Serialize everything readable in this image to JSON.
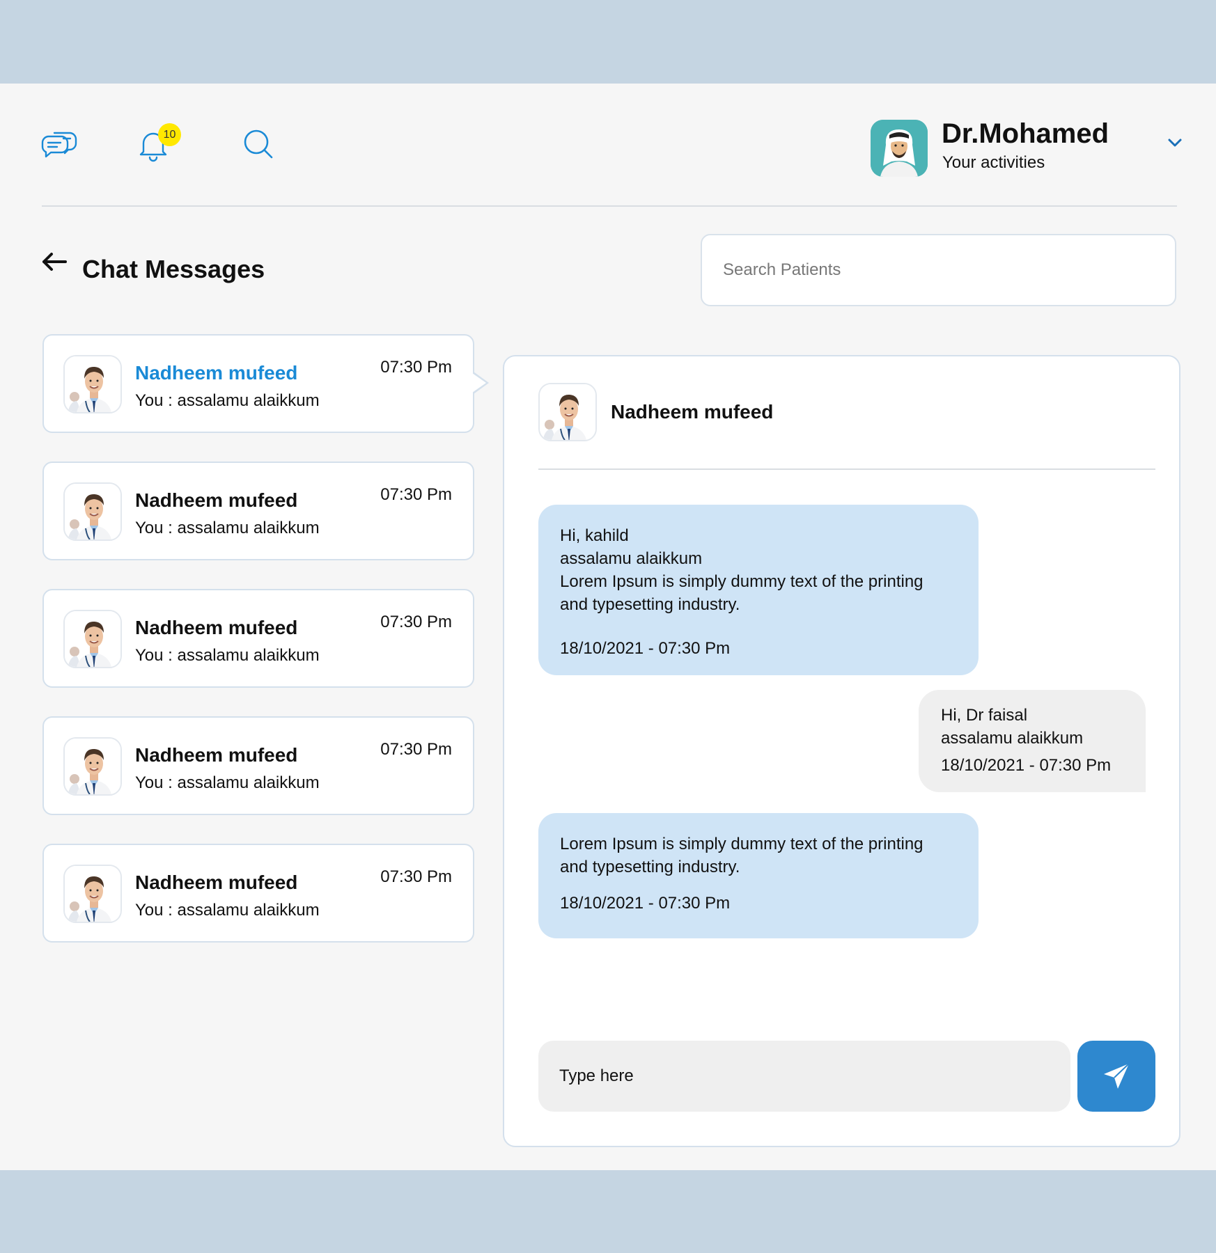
{
  "header": {
    "icons": [
      "chat-icon",
      "bell-icon",
      "search-icon"
    ],
    "notification_count": "10",
    "profile": {
      "name": "Dr.Mohamed",
      "subtitle": "Your activities"
    }
  },
  "page": {
    "title": "Chat Messages",
    "search_placeholder": "Search Patients"
  },
  "conversations": [
    {
      "name": "Nadheem mufeed",
      "preview": "You : assalamu alaikkum",
      "time": "07:30 Pm",
      "active": true
    },
    {
      "name": "Nadheem mufeed",
      "preview": "You : assalamu alaikkum",
      "time": "07:30 Pm",
      "active": false
    },
    {
      "name": "Nadheem mufeed",
      "preview": "You : assalamu alaikkum",
      "time": "07:30 Pm",
      "active": false
    },
    {
      "name": "Nadheem mufeed",
      "preview": "You : assalamu alaikkum",
      "time": "07:30 Pm",
      "active": false
    },
    {
      "name": "Nadheem mufeed",
      "preview": "You : assalamu alaikkum",
      "time": "07:30 Pm",
      "active": false
    }
  ],
  "chat": {
    "contact_name": "Nadheem mufeed",
    "messages": [
      {
        "direction": "incoming",
        "lines": [
          "Hi, kahild",
          "assalamu alaikkum",
          "Lorem Ipsum is simply dummy text of the printing",
          "and typesetting industry."
        ],
        "time": "18/10/2021 - 07:30 Pm"
      },
      {
        "direction": "outgoing",
        "lines": [
          "Hi, Dr faisal",
          "assalamu alaikkum"
        ],
        "time": "18/10/2021 - 07:30 Pm"
      },
      {
        "direction": "incoming",
        "lines": [
          "Lorem Ipsum is simply dummy text of the printing",
          "and typesetting industry."
        ],
        "time": "18/10/2021 - 07:30 Pm"
      }
    ],
    "compose_placeholder": "Type here"
  },
  "colors": {
    "accent": "#2e88cf",
    "active_name": "#1a8ad6",
    "incoming_bubble": "#cfe4f6",
    "outgoing_bubble": "#efefef",
    "badge": "#ffe800",
    "frame": "#c5d5e2"
  }
}
